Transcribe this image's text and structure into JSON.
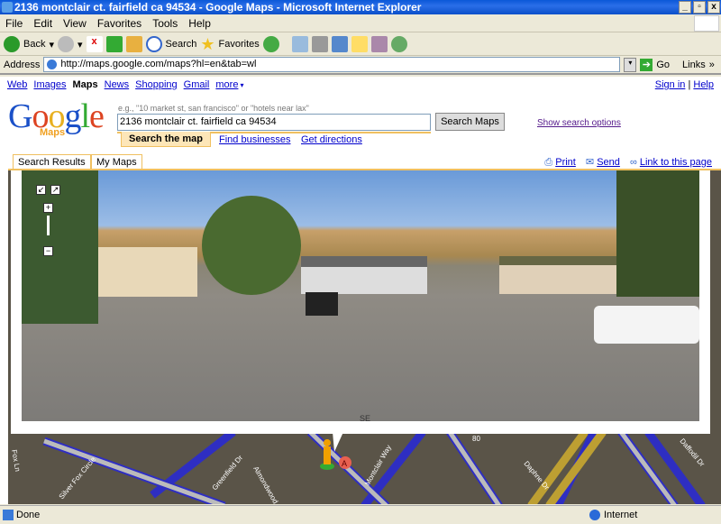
{
  "window": {
    "title": "2136 montclair ct. fairfield ca 94534 - Google Maps - Microsoft Internet Explorer"
  },
  "menu": [
    "File",
    "Edit",
    "View",
    "Favorites",
    "Tools",
    "Help"
  ],
  "toolbar": {
    "back": "Back",
    "search": "Search",
    "favorites": "Favorites"
  },
  "address": {
    "label": "Address",
    "url": "http://maps.google.com/maps?hl=en&tab=wl",
    "go": "Go",
    "links": "Links"
  },
  "gnav": {
    "items": [
      "Web",
      "Images",
      "Maps",
      "News",
      "Shopping",
      "Gmail",
      "more"
    ],
    "sign_in": "Sign in",
    "help": "Help"
  },
  "logo": {
    "text": "Google",
    "sub": "Maps"
  },
  "search": {
    "hint": "e.g., \"10 market st, san francisco\" or \"hotels near lax\"",
    "value": "2136 montclair ct. fairfield ca 94534",
    "button": "Search Maps",
    "options": "Show search options",
    "tabs": [
      "Search the map",
      "Find businesses",
      "Get directions"
    ]
  },
  "panel_tabs": [
    "Search Results",
    "My Maps"
  ],
  "actions": [
    "Print",
    "Send",
    "Link to this page"
  ],
  "streetview": {
    "heading": "SE"
  },
  "map": {
    "streets": [
      "Silver Fox Circle",
      "Greenfield Dr",
      "Almondwood",
      "Montclair Way",
      "Daphne Dr",
      "Daffodil Dr",
      "Fox Ln",
      "80"
    ],
    "marker": "A"
  },
  "status": {
    "text": "Done",
    "zone": "Internet"
  }
}
